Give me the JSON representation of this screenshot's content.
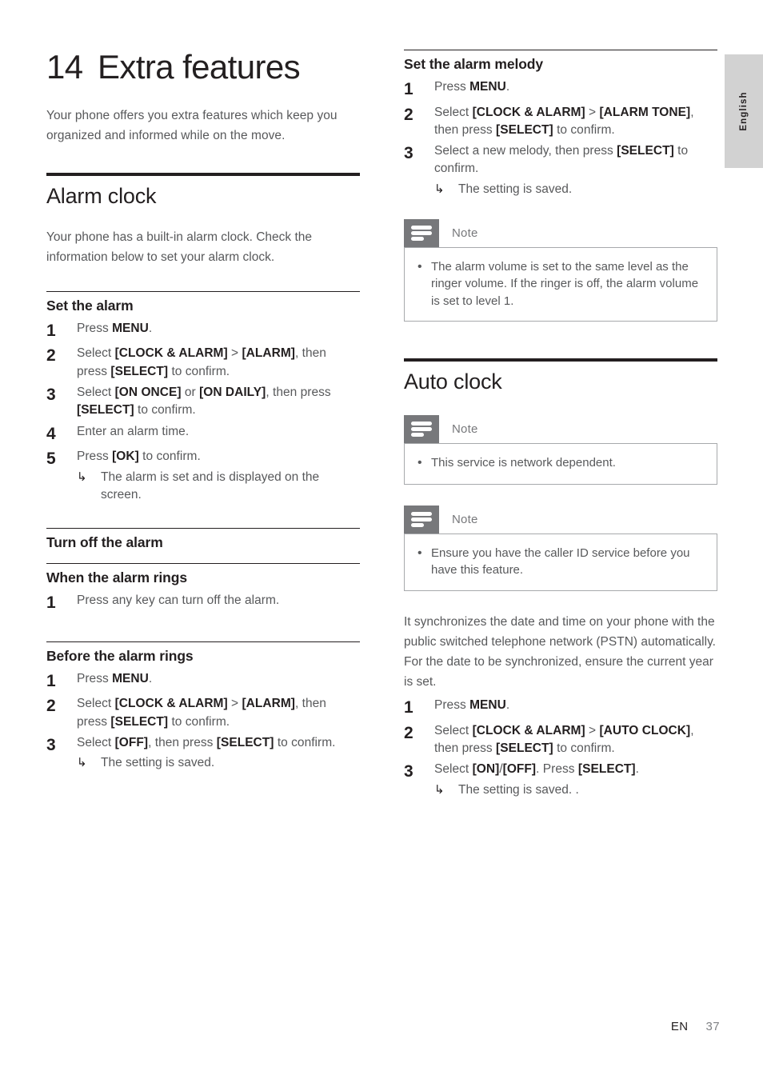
{
  "language_tab": {
    "label": "English"
  },
  "footer": {
    "locale": "EN",
    "page_number": "37"
  },
  "chapter": {
    "number": "14",
    "title": "Extra features",
    "intro": "Your phone offers you extra features which keep you organized and informed while on the move."
  },
  "left_column": {
    "section": {
      "title": "Alarm clock",
      "body": "Your phone has a built-in alarm clock. Check the information below to set your alarm clock."
    },
    "set_the_alarm": {
      "heading": "Set the alarm",
      "steps": [
        {
          "marker": "1",
          "text": "Press <b>MENU</b>."
        },
        {
          "marker": "2",
          "text": "Select <b>[CLOCK &amp; ALARM]</b> &gt; <b>[ALARM]</b>, then press <b>[SELECT]</b> to confirm."
        },
        {
          "marker": "3",
          "text": "Select <b>[ON ONCE]</b> or <b>[ON DAILY]</b>, then press <b>[SELECT]</b> to confirm."
        },
        {
          "marker": "4",
          "text": "Enter an alarm time."
        },
        {
          "marker": "5",
          "text": "Press <b>[OK]</b> to confirm.",
          "result": "The alarm is set and is displayed on the screen."
        }
      ]
    },
    "turn_off_the_alarm": {
      "heading": "Turn off the alarm",
      "when_rings": {
        "heading": "When the alarm rings",
        "steps": [
          {
            "marker": "1",
            "text": "Press any key can turn off the alarm."
          }
        ]
      },
      "before_rings": {
        "heading": "Before the alarm rings",
        "steps": [
          {
            "marker": "1",
            "text": "Press <b>MENU</b>."
          },
          {
            "marker": "2",
            "text": "Select <b>[CLOCK &amp; ALARM]</b> &gt; <b>[ALARM]</b>, then press <b>[SELECT]</b> to confirm."
          },
          {
            "marker": "3",
            "text": "Select <b>[OFF]</b>, then press <b>[SELECT]</b> to confirm.",
            "result": "The setting is saved."
          }
        ]
      }
    }
  },
  "right_column": {
    "set_the_alarm_melody": {
      "heading": "Set the alarm melody",
      "steps": [
        {
          "marker": "1",
          "text": "Press <b>MENU</b>."
        },
        {
          "marker": "2",
          "text": "Select <b>[CLOCK &amp; ALARM]</b> &gt; <b>[ALARM TONE]</b>, then press <b>[SELECT]</b> to confirm."
        },
        {
          "marker": "3",
          "text": "Select a new melody, then press <b>[SELECT]</b> to confirm.",
          "result": "The setting is saved."
        }
      ],
      "note": {
        "title": "Note",
        "items": [
          "The alarm volume is set to the same level as the ringer volume. If the ringer is off, the alarm volume is set to level 1."
        ]
      }
    },
    "auto_clock": {
      "title": "Auto clock",
      "note_1": {
        "title": "Note",
        "items": [
          "This service is network dependent."
        ]
      },
      "note_2": {
        "title": "Note",
        "items": [
          "Ensure you have the caller ID service before you have this feature."
        ]
      },
      "body": "It synchronizes the date and time on your phone with the public switched telephone network (PSTN) automatically. For the date to be synchronized, ensure the current year is set.",
      "steps": [
        {
          "marker": "1",
          "text": "Press <b>MENU</b>."
        },
        {
          "marker": "2",
          "text": "Select <b>[CLOCK &amp; ALARM]</b> &gt; <b>[AUTO CLOCK]</b>, then press <b>[SELECT]</b> to confirm."
        },
        {
          "marker": "3",
          "text": "Select <b>[ON]</b>/<b>[OFF]</b>. Press <b>[SELECT]</b>.",
          "result": "The setting is saved. ."
        }
      ]
    }
  },
  "icons": {
    "note_icon": "note-lines-icon",
    "result_arrow": "↳",
    "bullet": "•"
  }
}
